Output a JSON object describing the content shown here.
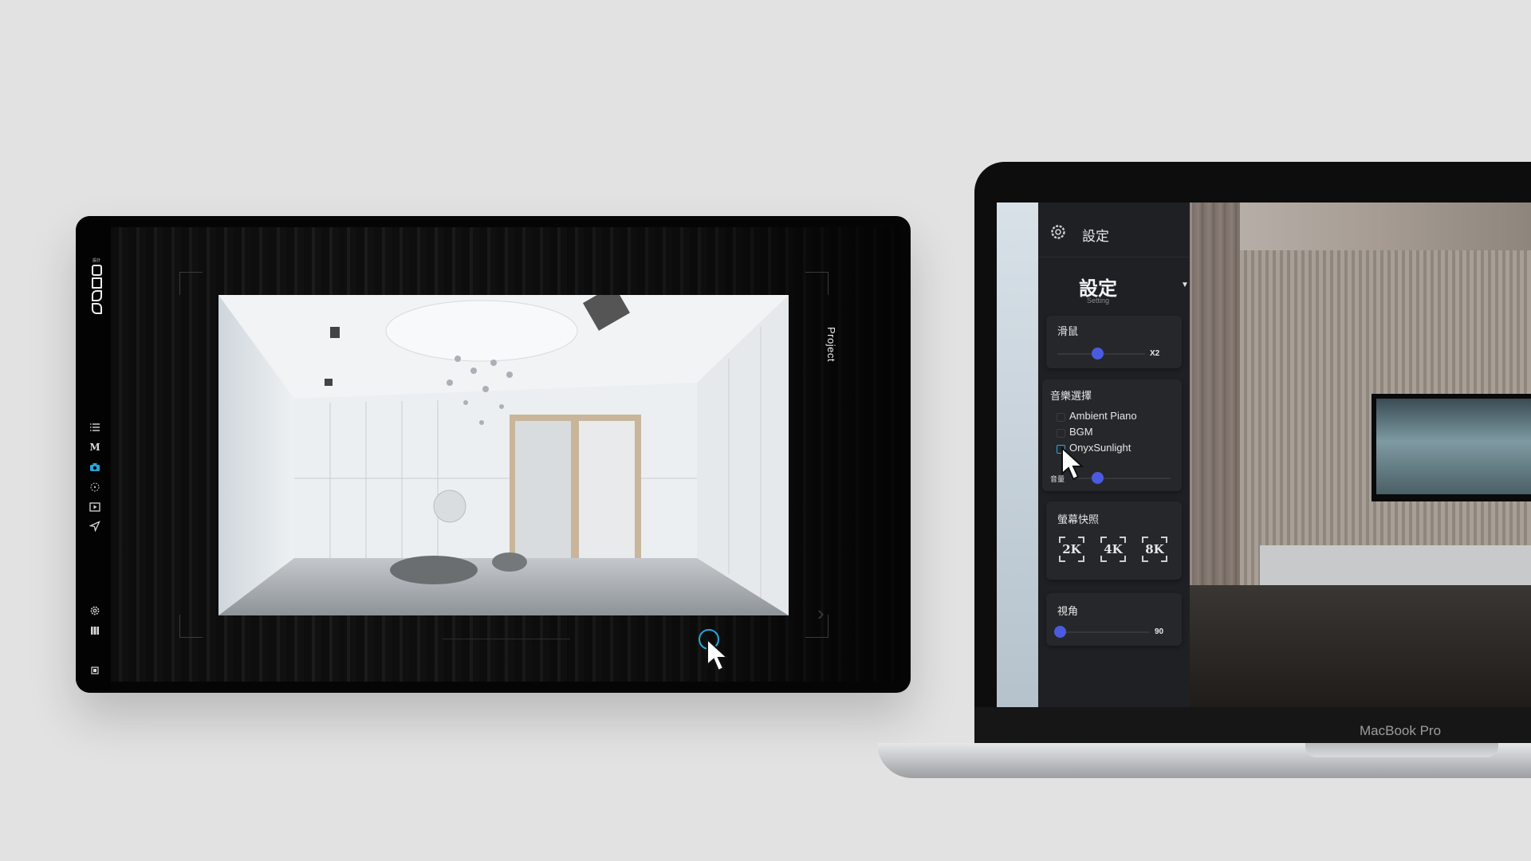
{
  "left_app": {
    "logo_small": "設計",
    "side_label": "Project",
    "rail_icons": [
      "list-icon",
      "m-icon",
      "camera-icon",
      "target-icon",
      "play-icon",
      "send-icon",
      "gear-icon",
      "film-icon",
      "square-icon"
    ],
    "accent": "#2aa6d9"
  },
  "laptop": {
    "brand_label": "MacBook Pro",
    "header": {
      "title": "設定"
    },
    "section": {
      "title": "設定",
      "subtitle": "Setting"
    },
    "mouse": {
      "label": "滑鼠",
      "value_label": "X2",
      "level": 0.35
    },
    "music": {
      "label": "音樂選擇",
      "options": [
        "Ambient Piano",
        "BGM",
        "OnyxSunlight"
      ],
      "selected": "OnyxSunlight",
      "volume_label": "音量",
      "volume_level": 0.35
    },
    "snapshot": {
      "label": "螢幕快照",
      "options": [
        "2K",
        "4K",
        "8K"
      ]
    },
    "fov": {
      "label": "視角",
      "value_label": "90",
      "level": 0
    }
  }
}
